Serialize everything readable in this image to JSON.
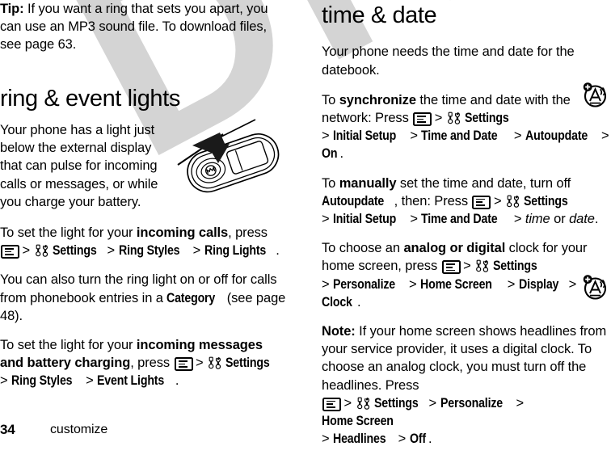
{
  "document": {
    "watermark": "DRAFT",
    "footer": {
      "page_number": "34",
      "section_label": "customize"
    }
  },
  "icons": {
    "menu_key": "menu-key-icon",
    "settings": "settings-wrench-icon",
    "margin_feature": "network-audio-icon",
    "phone_illustration": "phone-ring-light-illustration"
  },
  "left_column": {
    "tip": {
      "label": "Tip:",
      "text": " If you want a ring that sets you apart, you can use an MP3 sound file. To download files, see page 63."
    },
    "section_title": "ring & event lights",
    "intro": "Your phone has a light just below the external display that can pulse for incoming calls or messages, or while you charge your battery.",
    "incoming_calls": {
      "lead": "To set the light for your ",
      "bold": "incoming calls",
      "tail": ", press ",
      "path": [
        "Settings",
        "Ring Styles",
        "Ring Lights"
      ],
      "end": "."
    },
    "phonebook": {
      "lead": "You can also turn the ring light on or off for calls from phonebook entries in a ",
      "bold": "Category",
      "tail": " (see page 48)."
    },
    "incoming_messages": {
      "lead": "To set the light for your ",
      "bold": "incoming messages and battery charging",
      "tail": ", press ",
      "path": [
        "Settings",
        "Ring Styles",
        "Event Lights"
      ],
      "end": "."
    }
  },
  "right_column": {
    "section_title": "time & date",
    "intro": "Your phone needs the time and date for the datebook.",
    "synchronize": {
      "lead": "To ",
      "bold": "synchronize",
      "mid": " the time and date with the network: Press ",
      "path": [
        "Settings",
        "Initial Setup",
        "Time and Date",
        "Autoupdate",
        "On"
      ],
      "end": "."
    },
    "manually": {
      "lead": "To ",
      "bold": "manually",
      "mid": " set the time and date, turn off ",
      "bold2": "Autoupdate",
      "mid2": ", then: Press ",
      "path": [
        "Settings",
        "Initial Setup",
        "Time and Date"
      ],
      "italic_a": "time",
      "between": " or ",
      "italic_b": "date",
      "end": "."
    },
    "clock": {
      "lead": "To choose an ",
      "bold": "analog or digital",
      "mid": " clock for your home screen, press ",
      "path": [
        "Settings",
        "Personalize",
        "Home Screen",
        "Display",
        "Clock"
      ],
      "end": "."
    },
    "note": {
      "label": "Note:",
      "text": " If your home screen shows headlines from your service provider, it uses a digital clock. To choose an analog clock, you must turn off the headlines. Press ",
      "path": [
        "Settings",
        "Personalize",
        "Home Screen",
        "Headlines",
        "Off"
      ],
      "end": "."
    }
  }
}
